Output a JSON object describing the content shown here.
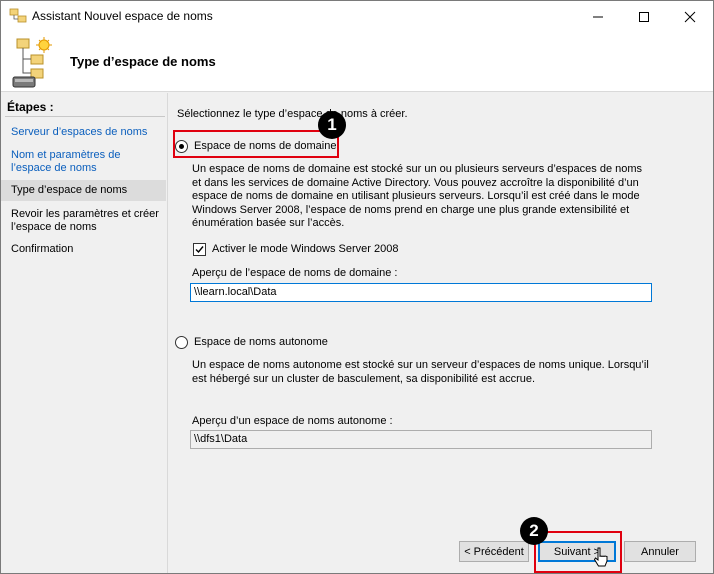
{
  "window": {
    "title": "Assistant Nouvel espace de noms",
    "minimize_icon": "minimize-icon",
    "maximize_icon": "maximize-icon",
    "close_icon": "close-icon"
  },
  "header": {
    "title": "Type d’espace de noms"
  },
  "sidebar": {
    "title": "Étapes :",
    "items": [
      {
        "label": "Serveur d’espaces de noms"
      },
      {
        "label": "Nom et paramètres de l’espace de noms"
      },
      {
        "label": "Type d’espace de noms"
      },
      {
        "label": "Revoir les paramètres et créer l’espace de noms"
      },
      {
        "label": "Confirmation"
      }
    ]
  },
  "content": {
    "prompt": "Sélectionnez le type d’espace de noms à créer.",
    "domain_option": {
      "label": "Espace de noms de domaine",
      "selected": true,
      "description": "Un espace de noms de domaine est stocké sur un ou plusieurs serveurs d’espaces de noms et dans les services de domaine Active Directory. Vous pouvez accroître la disponibilité d’un espace de noms de domaine en utilisant plusieurs serveurs. Lorsqu’il est créé dans le mode Windows Server 2008, l’espace de noms prend en charge une plus grande extensibilité et énumération basée sur l’accès.",
      "checkbox_label": "Activer le mode Windows Server 2008",
      "checkbox_checked": true,
      "preview_label": "Aperçu de l’espace de noms de domaine :",
      "preview_value": "\\\\learn.local\\Data"
    },
    "standalone_option": {
      "label": "Espace de noms autonome",
      "selected": false,
      "description": "Un espace de noms autonome est stocké sur un serveur d’espaces de noms unique. Lorsqu’il est hébergé sur un cluster de basculement, sa disponibilité est accrue.",
      "preview_label": "Aperçu d’un espace de noms autonome :",
      "preview_value": "\\\\dfs1\\Data"
    }
  },
  "buttons": {
    "previous": "< Précédent",
    "next": "Suivant >",
    "cancel": "Annuler"
  },
  "annotations": {
    "badge1": "1",
    "badge2": "2",
    "highlight_color": "#e0000f"
  }
}
